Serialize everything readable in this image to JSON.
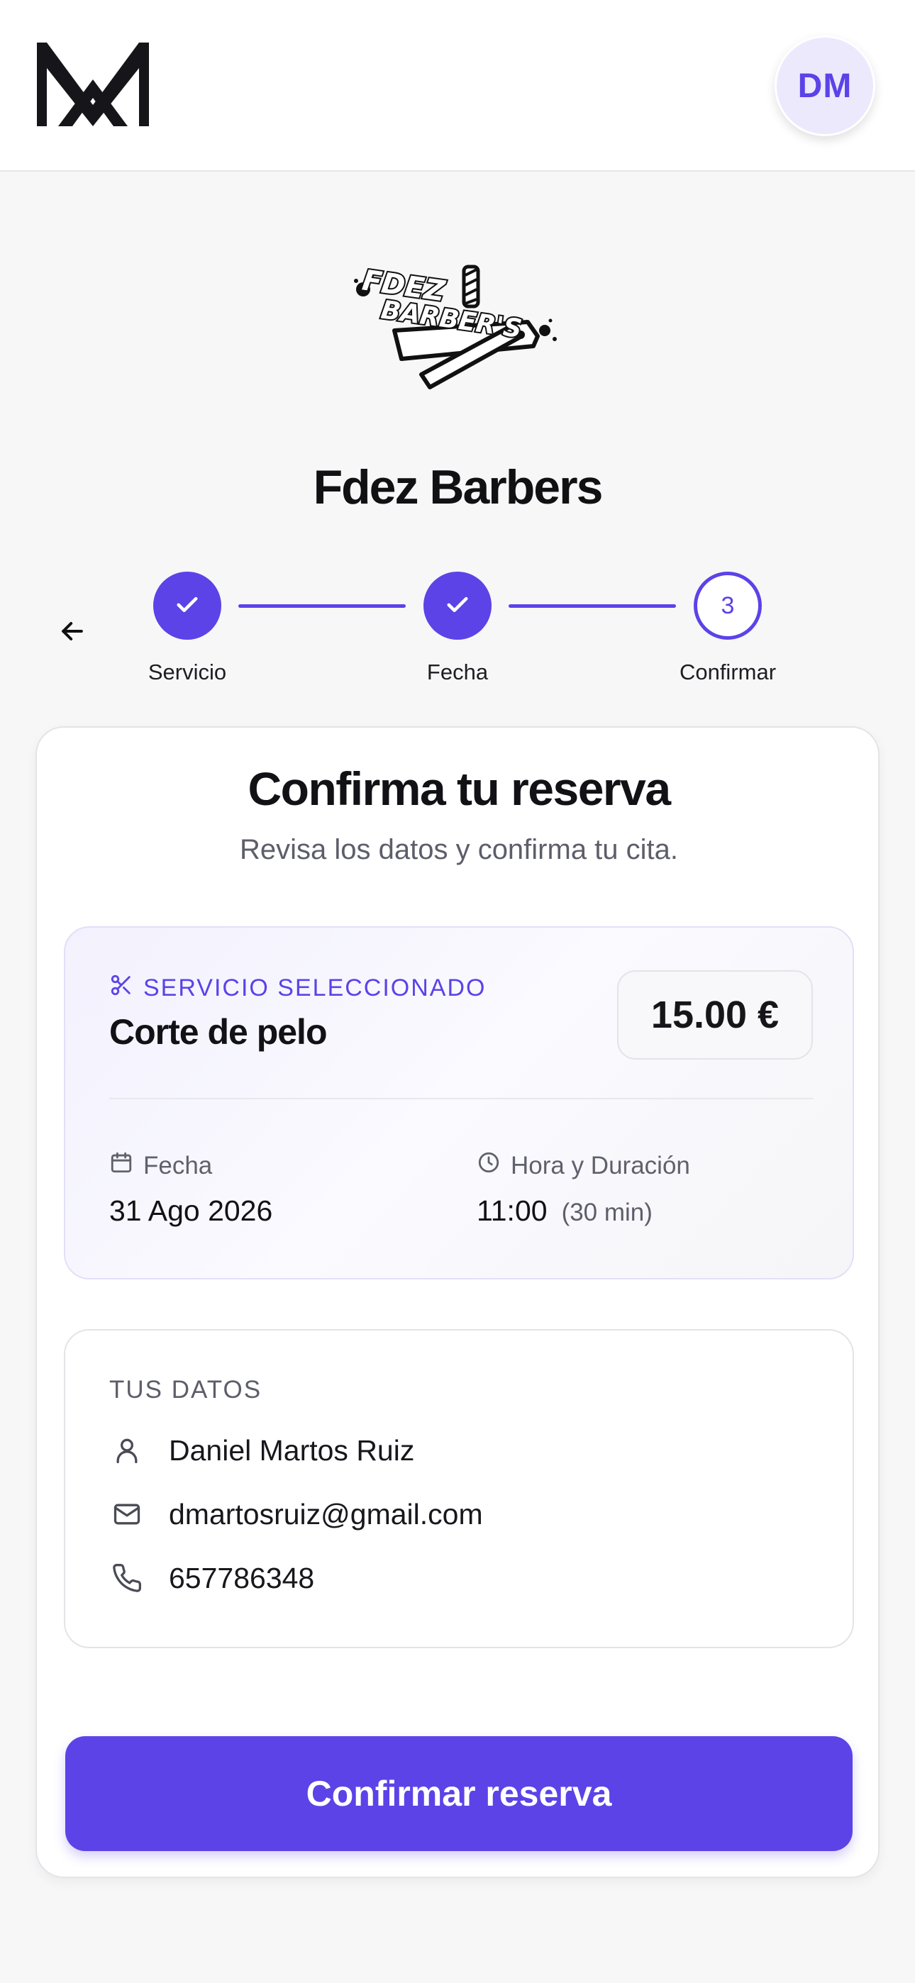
{
  "header": {
    "avatar_initials": "DM"
  },
  "shop": {
    "logo_text_line1": "FDEZ",
    "logo_text_line2": "BARBER'S",
    "name": "Fdez Barbers"
  },
  "stepper": {
    "steps": [
      {
        "label": "Servicio",
        "state": "done"
      },
      {
        "label": "Fecha",
        "state": "done"
      },
      {
        "label": "Confirmar",
        "state": "current",
        "number": "3"
      }
    ]
  },
  "confirm": {
    "title": "Confirma tu reserva",
    "subtitle": "Revisa los datos y confirma tu cita.",
    "service": {
      "label": "SERVICIO SELECCIONADO",
      "name": "Corte de pelo",
      "price": "15.00 €",
      "date_label": "Fecha",
      "date_value": "31 Ago 2026",
      "time_label": "Hora y Duración",
      "time_value": "11:00",
      "duration": "(30 min)"
    },
    "user": {
      "title": "TUS DATOS",
      "name": "Daniel Martos Ruiz",
      "email": "dmartosruiz@gmail.com",
      "phone": "657786348"
    },
    "button_label": "Confirmar reserva"
  },
  "colors": {
    "accent": "#5b43e8",
    "avatar_bg": "#ece9fd",
    "page_bg": "#f7f7f8"
  },
  "icons": [
    "app-logo",
    "shop-logo",
    "back-arrow-icon",
    "check-icon",
    "scissors-icon",
    "calendar-icon",
    "clock-icon",
    "user-icon",
    "mail-icon",
    "phone-icon"
  ]
}
